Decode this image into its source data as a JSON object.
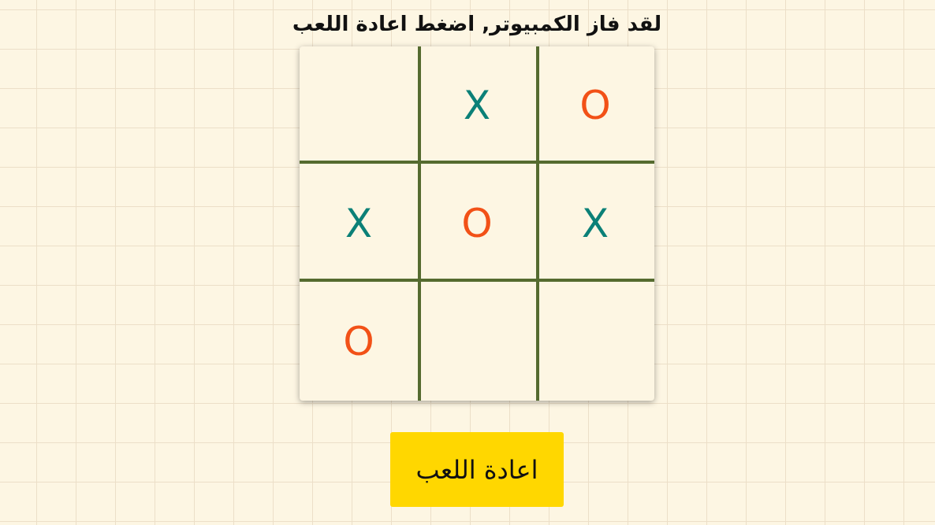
{
  "status_message": "لقد فاز الكمبيوتر, اضغط اعادة اللعب",
  "board": {
    "cells": [
      "",
      "X",
      "O",
      "X",
      "O",
      "X",
      "O",
      "",
      ""
    ]
  },
  "restart_label": "اعادة اللعب",
  "colors": {
    "background": "#fdf6e3",
    "grid_lines": "#556b2f",
    "x_mark": "#0b8077",
    "o_mark": "#f25117",
    "button": "#ffd700"
  }
}
